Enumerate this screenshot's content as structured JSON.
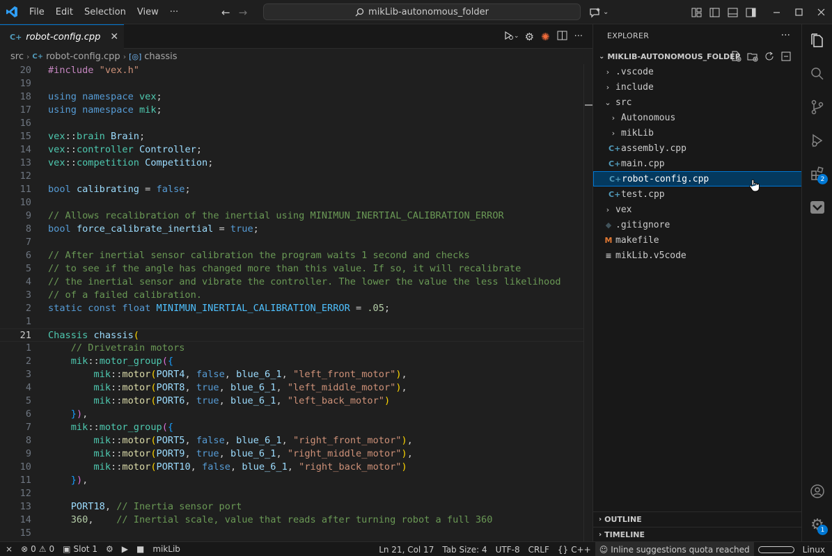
{
  "colors": {
    "accent": "#0078d4",
    "selection_bg": "#04395e",
    "editor_bg": "#1f1f1f",
    "sidebar_bg": "#181818"
  },
  "titlebar": {
    "menu": [
      "File",
      "Edit",
      "Selection",
      "View",
      "···"
    ],
    "search_text": "mikLib-autonomous_folder"
  },
  "tab": {
    "label": "robot-config.cpp",
    "close": "✕"
  },
  "breadcrumb": {
    "items": [
      "src",
      "robot-config.cpp",
      "chassis"
    ]
  },
  "editor": {
    "current_line": "21"
  },
  "explorer": {
    "header": "EXPLORER",
    "folder": "MIKLIB-AUTONOMOUS_FOLDER",
    "items": [
      {
        "label": ".vscode",
        "kind": "folder",
        "expanded": false,
        "depth": 0
      },
      {
        "label": "include",
        "kind": "folder",
        "expanded": false,
        "depth": 0
      },
      {
        "label": "src",
        "kind": "folder",
        "expanded": true,
        "depth": 0
      },
      {
        "label": "Autonomous",
        "kind": "folder",
        "expanded": false,
        "depth": 1
      },
      {
        "label": "mikLib",
        "kind": "folder",
        "expanded": false,
        "depth": 1
      },
      {
        "label": "assembly.cpp",
        "kind": "cpp",
        "depth": 1
      },
      {
        "label": "main.cpp",
        "kind": "cpp",
        "depth": 1
      },
      {
        "label": "robot-config.cpp",
        "kind": "cpp",
        "depth": 1,
        "selected": true
      },
      {
        "label": "test.cpp",
        "kind": "cpp",
        "depth": 1
      },
      {
        "label": "vex",
        "kind": "folder",
        "expanded": false,
        "depth": 0
      },
      {
        "label": ".gitignore",
        "kind": "git",
        "depth": 0
      },
      {
        "label": "makefile",
        "kind": "make",
        "depth": 0
      },
      {
        "label": "mikLib.v5code",
        "kind": "text",
        "depth": 0
      }
    ],
    "outline": "OUTLINE",
    "timeline": "TIMELINE"
  },
  "activitybar": {
    "extensions_badge": "2",
    "settings_badge": "1"
  },
  "status": {
    "errors": "0",
    "warnings": "0",
    "slot": "Slot 1",
    "project": "mikLib",
    "cursor": "Ln 21, Col 17",
    "tab_size": "Tab Size: 4",
    "encoding": "UTF-8",
    "eol": "CRLF",
    "language": "C++",
    "copilot": "Inline suggestions quota reached",
    "os": "Linux"
  }
}
